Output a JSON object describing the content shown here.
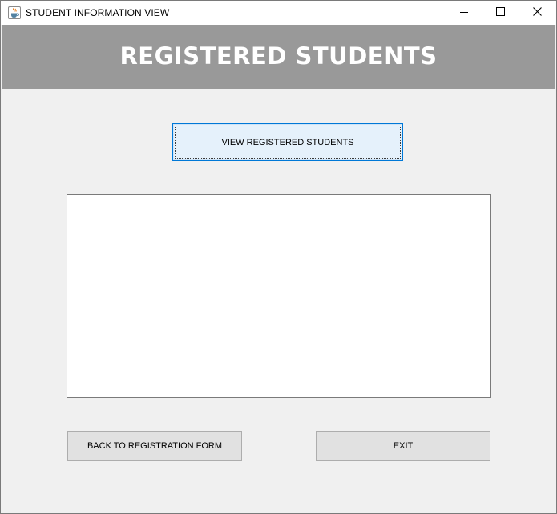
{
  "window": {
    "title": "STUDENT INFORMATION VIEW",
    "app_icon": "java-cup-icon",
    "controls": {
      "minimize_icon": "minimize-icon",
      "maximize_icon": "maximize-icon",
      "close_icon": "close-icon"
    }
  },
  "header": {
    "title": "REGISTERED STUDENTS",
    "background_color": "#999999",
    "text_color": "#ffffff"
  },
  "actions": {
    "view_label": "VIEW REGISTERED STUDENTS",
    "back_label": "BACK TO REGISTRATION FORM",
    "exit_label": "EXIT"
  },
  "output": {
    "value": ""
  },
  "colors": {
    "window_background": "#f0f0f0",
    "focus_border": "#0078d7"
  }
}
